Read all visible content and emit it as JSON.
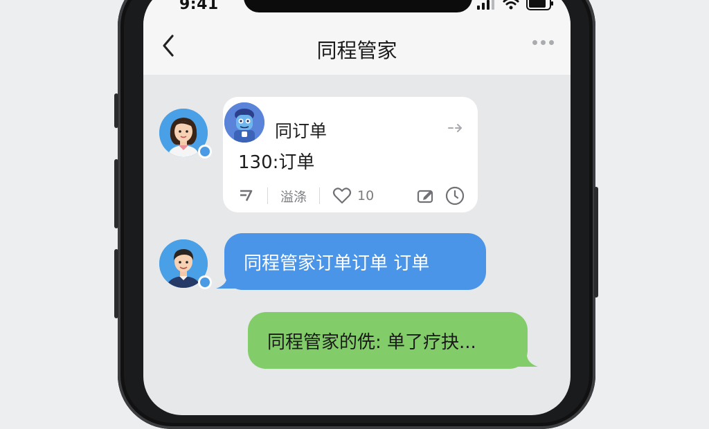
{
  "status_bar": {
    "time": "9:41"
  },
  "header": {
    "title": "同程管家"
  },
  "messages": [
    {
      "type": "order_card",
      "card_title": "同订单",
      "card_body": "130:订单",
      "footer_left_label": "溢涤",
      "like_count": "10"
    },
    {
      "type": "text",
      "side": "left",
      "text": "同程管家订单订单 订单"
    },
    {
      "type": "text",
      "side": "right",
      "text": "同程管家的侁: 单了疗抉..."
    }
  ],
  "colors": {
    "incoming_bubble": "#4b95e8",
    "outgoing_bubble": "#82cd6a",
    "chat_background": "#e7e8ea"
  }
}
